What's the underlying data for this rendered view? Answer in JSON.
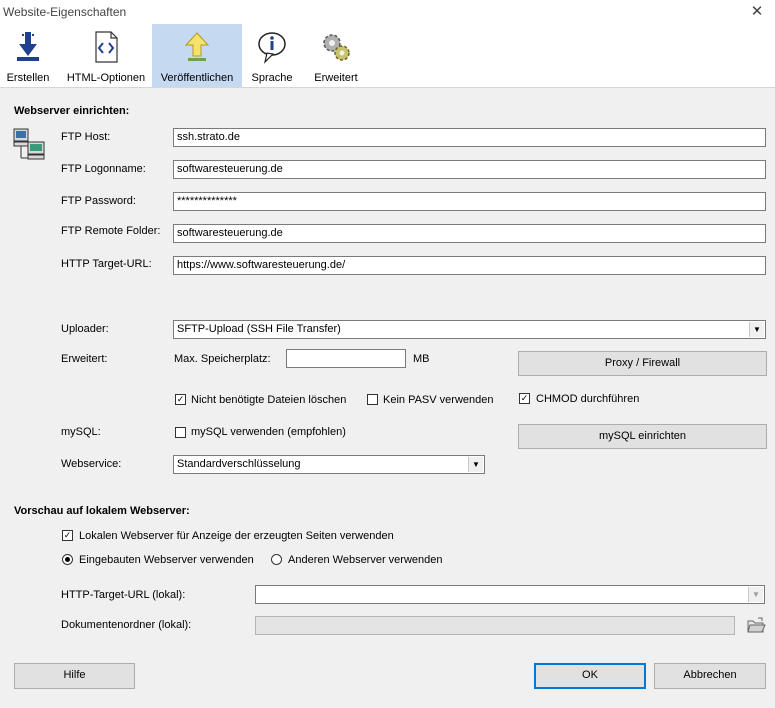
{
  "window": {
    "title": "Website-Eigenschaften",
    "close_glyph": "✕"
  },
  "toolbar": {
    "items": [
      {
        "label": "Erstellen",
        "icon": "download-arrow-icon",
        "active": false
      },
      {
        "label": "HTML-Optionen",
        "icon": "code-document-icon",
        "active": false
      },
      {
        "label": "Veröffentlichen",
        "icon": "upload-arrow-icon",
        "active": true
      },
      {
        "label": "Sprache",
        "icon": "info-speech-icon",
        "active": false
      },
      {
        "label": "Erweitert",
        "icon": "gears-icon",
        "active": false
      }
    ]
  },
  "webserver": {
    "section_title": "Webserver einrichten:",
    "ftp_host_label": "FTP Host:",
    "ftp_host_value": "ssh.strato.de",
    "ftp_logon_label": "FTP Logonname:",
    "ftp_logon_value": "softwaresteuerung.de",
    "ftp_password_label": "FTP Password:",
    "ftp_password_value": "**************",
    "ftp_folder_label": "FTP Remote Folder:",
    "ftp_folder_value": "softwaresteuerung.de",
    "http_target_label": "HTTP Target-URL:",
    "http_target_value": "https://www.softwaresteuerung.de/",
    "uploader_label": "Uploader:",
    "uploader_value": "SFTP-Upload (SSH File Transfer)",
    "erweitert_label": "Erweitert:",
    "max_storage_label": "Max. Speicherplatz:",
    "max_storage_value": "",
    "max_storage_unit": "MB",
    "proxy_button": "Proxy / Firewall",
    "delete_unneeded_label": "Nicht benötigte Dateien löschen",
    "delete_unneeded_checked": true,
    "no_pasv_label": "Kein PASV verwenden",
    "no_pasv_checked": false,
    "chmod_label": "CHMOD durchführen",
    "chmod_checked": true,
    "mysql_label": "mySQL:",
    "mysql_use_label": "mySQL verwenden (empfohlen)",
    "mysql_use_checked": false,
    "mysql_setup_button": "mySQL einrichten",
    "webservice_label": "Webservice:",
    "webservice_value": "Standardverschlüsselung"
  },
  "preview": {
    "section_title": "Vorschau auf lokalem Webserver:",
    "local_server_label": "Lokalen Webserver für Anzeige der erzeugten Seiten verwenden",
    "local_server_checked": true,
    "builtin_server_label": "Eingebauten Webserver verwenden",
    "builtin_server_selected": true,
    "other_server_label": "Anderen Webserver verwenden",
    "other_server_selected": false,
    "http_target_local_label": "HTTP-Target-URL (lokal):",
    "http_target_local_value": "",
    "doc_folder_label": "Dokumentenordner (lokal):",
    "doc_folder_value": ""
  },
  "footer": {
    "help_button": "Hilfe",
    "ok_button": "OK",
    "cancel_button": "Abbrechen"
  },
  "colors": {
    "active_tab": "#c5d9f1",
    "dialog_bg": "#f0f0f0",
    "default_button_border": "#0078d7"
  }
}
